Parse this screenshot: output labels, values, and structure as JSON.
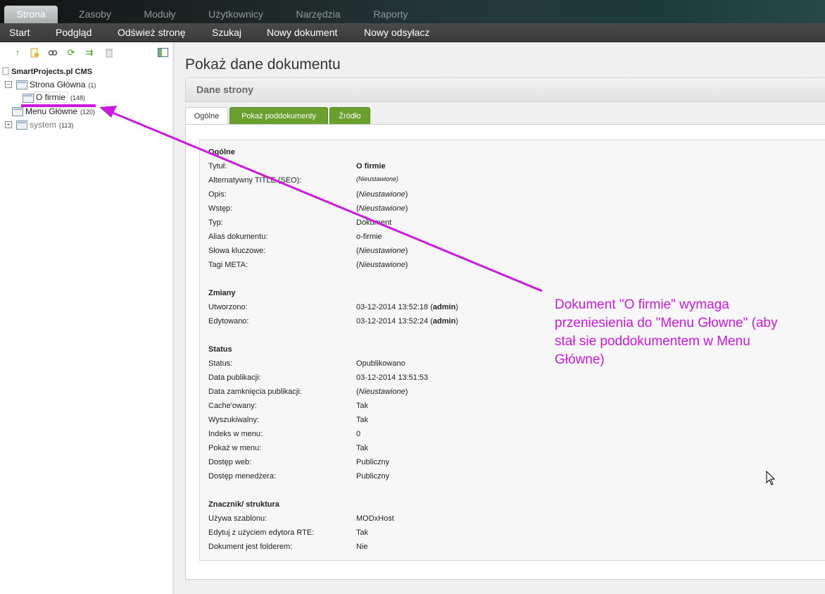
{
  "top_tabs": [
    "Strona",
    "Zasoby",
    "Moduły",
    "Użytkownicy",
    "Narzędzia",
    "Raporty"
  ],
  "sub_menu": [
    "Start",
    "Podgląd",
    "Odśwież stronę",
    "Szukaj",
    "Nowy dokument",
    "Nowy odsyłacz"
  ],
  "tree": {
    "root": "SmartProjects.pl CMS",
    "nodes": [
      {
        "label": "Strona Główna",
        "count": "(1)",
        "expander": "−"
      },
      {
        "label": "O firmie",
        "count": "(148)"
      },
      {
        "label": "Menu Główne",
        "count": "(120)"
      },
      {
        "label": "system",
        "count": "(113)",
        "expander": "+"
      }
    ]
  },
  "page_title": "Pokaż dane dokumentu",
  "section_title": "Dane strony",
  "tabs": [
    "Ogólne",
    "Pokaż poddokumenty",
    "Źródło"
  ],
  "sections": {
    "general": {
      "header": "Ogólne",
      "rows": [
        {
          "label": "Tytuł:",
          "value": "O firmie"
        },
        {
          "label": "Alternatywny TITLE (SEO):",
          "value": "(Nieustawione)"
        },
        {
          "label": "Opis:",
          "value": "Nieustawione"
        },
        {
          "label": "Wstęp:",
          "value": "Nieustawione"
        },
        {
          "label": "Typ:",
          "value": "Dokument"
        },
        {
          "label": "Alias dokumentu:",
          "value": "o-firmie"
        },
        {
          "label": "Słowa kluczowe:",
          "value": "Nieustawione"
        },
        {
          "label": "Tagi META:",
          "value": "Nieustawione"
        }
      ]
    },
    "changes": {
      "header": "Zmiany",
      "rows": [
        {
          "label": "Utworzono:",
          "value": "03-12-2014 13:52:18",
          "user": "admin"
        },
        {
          "label": "Edytowano:",
          "value": "03-12-2014 13:52:24",
          "user": "admin"
        }
      ]
    },
    "status": {
      "header": "Status",
      "rows": [
        {
          "label": "Status:",
          "value": "Opublikowano"
        },
        {
          "label": "Data publikacji:",
          "value": "03-12-2014 13:51:53"
        },
        {
          "label": "Data zamknięcia publikacji:",
          "value": "Nieustawione"
        },
        {
          "label": "Cache'owany:",
          "value": "Tak"
        },
        {
          "label": "Wyszukiwalny:",
          "value": "Tak"
        },
        {
          "label": "Indeks w menu:",
          "value": "0"
        },
        {
          "label": "Pokaż w menu:",
          "value": "Tak"
        },
        {
          "label": "Dostęp web:",
          "value": "Publiczny"
        },
        {
          "label": "Dostęp menedżera:",
          "value": "Publiczny"
        }
      ]
    },
    "structure": {
      "header": "Znacznik/ struktura",
      "rows": [
        {
          "label": "Używa szablonu:",
          "value": "MODxHost"
        },
        {
          "label": "Edytuj z użyciem edytora RTE:",
          "value": "Tak"
        },
        {
          "label": "Dokument jest folderem:",
          "value": "Nie"
        }
      ]
    }
  },
  "annotation": "Dokument \"O firmie\" wymaga przeniesienia do \"Menu Głowne\" (aby stał sie poddokumentem w Menu Główne)",
  "colors": {
    "annotation": "#cc19e0",
    "tab_green": "#6aa12e",
    "active_top_tab": "#b7bcbc"
  },
  "icons": [
    "arrow-up-icon",
    "new-doc-icon",
    "link-icon",
    "refresh-icon",
    "sort-icon",
    "trash-icon",
    "collapse-panel-icon"
  ]
}
